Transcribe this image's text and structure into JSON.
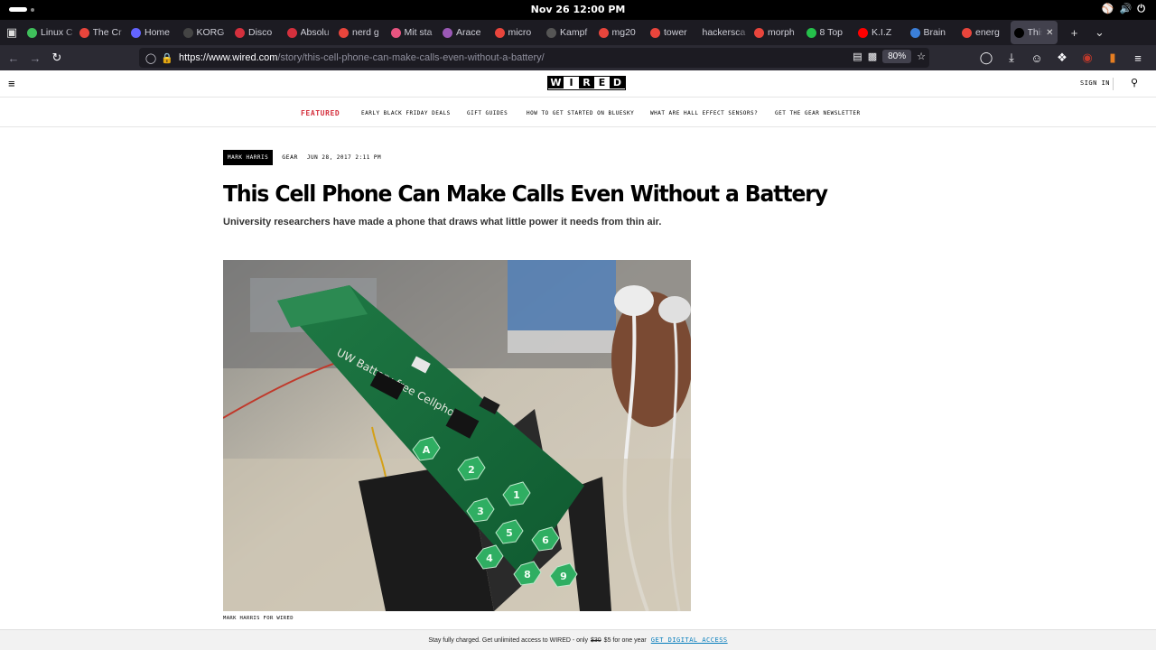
{
  "system": {
    "clock": "Nov 26  12:00 PM"
  },
  "tabs": [
    {
      "title": "Linux C",
      "icon": "speech-bubble-icon",
      "color": "#3fbf5b"
    },
    {
      "title": "The Cr",
      "icon": "chrome-icon",
      "color": "#e8453c"
    },
    {
      "title": "Home",
      "icon": "mastodon-icon",
      "color": "#6364ff"
    },
    {
      "title": "KORG",
      "icon": "korg-icon",
      "color": "#444444"
    },
    {
      "title": "Disco",
      "icon": "cherry-icon",
      "color": "#d4303d"
    },
    {
      "title": "Absolu",
      "icon": "circle-icon",
      "color": "#d4303d"
    },
    {
      "title": "nerd g",
      "icon": "chrome-icon",
      "color": "#e8453c"
    },
    {
      "title": "Mit sta",
      "icon": "pinwheel-icon",
      "color": "#e75480"
    },
    {
      "title": "Arace",
      "icon": "aracelis-icon",
      "color": "#9b59b6"
    },
    {
      "title": "micro",
      "icon": "chrome-icon",
      "color": "#e8453c"
    },
    {
      "title": "Kampf",
      "icon": "dark-circle-icon",
      "color": "#555555"
    },
    {
      "title": "mg20",
      "icon": "chrome-icon",
      "color": "#e8453c"
    },
    {
      "title": "tower",
      "icon": "chrome-icon",
      "color": "#e8453c"
    },
    {
      "title": "hackersca",
      "icon": "none",
      "color": "#1c1b22"
    },
    {
      "title": "morph",
      "icon": "chrome-icon",
      "color": "#e8453c"
    },
    {
      "title": "8 Top",
      "icon": "green-square-icon",
      "color": "#25c04b"
    },
    {
      "title": "K.I.Z",
      "icon": "youtube-icon",
      "color": "#ff0000"
    },
    {
      "title": "Brain",
      "icon": "ie-icon",
      "color": "#3b7fd9"
    },
    {
      "title": "energ",
      "icon": "chrome-icon",
      "color": "#e8453c"
    },
    {
      "title": "This",
      "icon": "wired-icon",
      "color": "#000000",
      "active": true
    }
  ],
  "navbar": {
    "url_host": "https://www.wired.com",
    "url_path": "/story/this-cell-phone-can-make-calls-even-without-a-battery/",
    "zoom": "80%"
  },
  "site": {
    "logo_letters": [
      "W",
      "I",
      "R",
      "E",
      "D"
    ],
    "sign_in": "SIGN IN",
    "subnav": {
      "featured": "FEATURED",
      "links": [
        "EARLY BLACK FRIDAY DEALS",
        "GIFT GUIDES",
        "HOW TO GET STARTED ON BLUESKY",
        "WHAT ARE HALL EFFECT SENSORS?",
        "GET THE GEAR NEWSLETTER"
      ]
    }
  },
  "article": {
    "author": "MARK HARRIS",
    "section": "GEAR",
    "date": "JUN 28, 2017 2:11 PM",
    "headline": "This Cell Phone Can Make Calls Even Without a Battery",
    "dek": "University researchers have made a phone that draws what little power it needs from thin air.",
    "caption": "MARK HARRIS FOR WIRED",
    "board_text": "UW Battery-free Cellphone",
    "keypad": [
      "A",
      "2",
      "1",
      "3",
      "5",
      "6",
      "4",
      "8",
      "9"
    ]
  },
  "paywall": {
    "text_before": "Stay fully charged. Get unlimited access to WIRED - only",
    "old_price": "$30",
    "text_after": "$5 for one year",
    "cta": "GET DIGITAL ACCESS"
  }
}
